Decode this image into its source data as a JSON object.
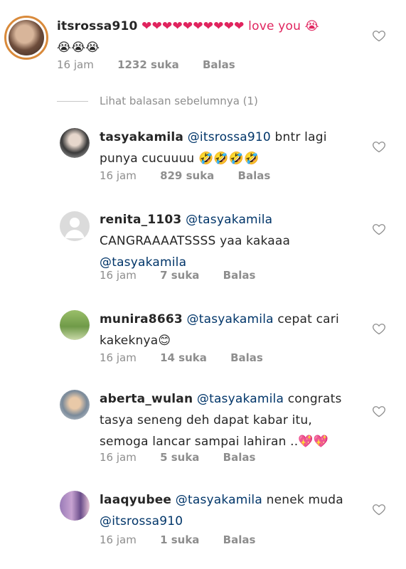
{
  "comments": [
    {
      "username": "itsrossa910",
      "mention": "",
      "text": "❤❤❤❤❤❤❤❤❤❤ love you 😭",
      "text2": "😭😭😭",
      "time": "16 jam",
      "likes": "1232 suka",
      "reply": "Balas"
    },
    {
      "username": "tasyakamila",
      "mention": "@itsrossa910",
      "text": " bntr lagi",
      "text2": "punya cucuuuu 🤣🤣🤣🤣",
      "time": "16 jam",
      "likes": "829 suka",
      "reply": "Balas"
    },
    {
      "username": "renita_1103",
      "mention": "@tasyakamila",
      "text": "CANGRAAAATSSSS yaa kakaaa",
      "mention2": "@tasyakamila",
      "time": "16 jam",
      "likes": "7 suka",
      "reply": "Balas"
    },
    {
      "username": "munira8663",
      "mention": "@tasyakamila",
      "text": " cepat cari",
      "text2": "kakeknya😊",
      "time": "16 jam",
      "likes": "14 suka",
      "reply": "Balas"
    },
    {
      "username": "aberta_wulan",
      "mention": "@tasyakamila",
      "text": " congrats",
      "text2": "tasya seneng deh dapat kabar itu,",
      "text3": "semoga lancar sampai lahiran ..💖💖",
      "time": "16 jam",
      "likes": "5 suka",
      "reply": "Balas"
    },
    {
      "username": "laaqyubee",
      "mention": "@tasyakamila",
      "text": " nenek muda",
      "mention2": "@itsrossa910",
      "time": "16 jam",
      "likes": "1 suka",
      "reply": "Balas"
    }
  ],
  "view_previous_replies": "Lihat balasan sebelumnya (1)",
  "colors": {
    "mention": "#003569",
    "meta": "#8e8e8e",
    "story_ring": "#d98a3b"
  }
}
